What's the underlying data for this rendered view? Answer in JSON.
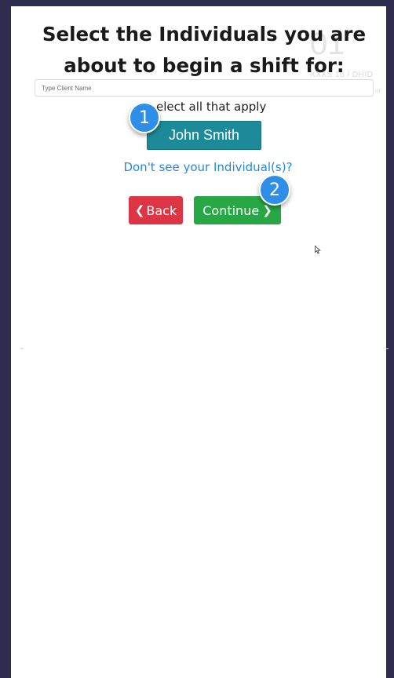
{
  "title": "Select the Individuals you are about to begin a shift for:",
  "search": {
    "placeholder": "Type Client Name"
  },
  "instruction": "elect all that apply",
  "clients": [
    {
      "label": "John Smith"
    }
  ],
  "missing_link": "Don't see your Individual(s)?",
  "buttons": {
    "back_label": "Back",
    "continue_label": "Continue"
  },
  "badges": [
    "1",
    "2"
  ],
  "background_text": {
    "number": "01",
    "small": "XXXS 10 / DHID",
    "side": "or"
  },
  "colors": {
    "frame": "#2e2d4d",
    "client_button": "#1c8a98",
    "link": "#2388e0",
    "back": "#dc3545",
    "continue": "#28a745",
    "badge": "#2f8fe8"
  }
}
